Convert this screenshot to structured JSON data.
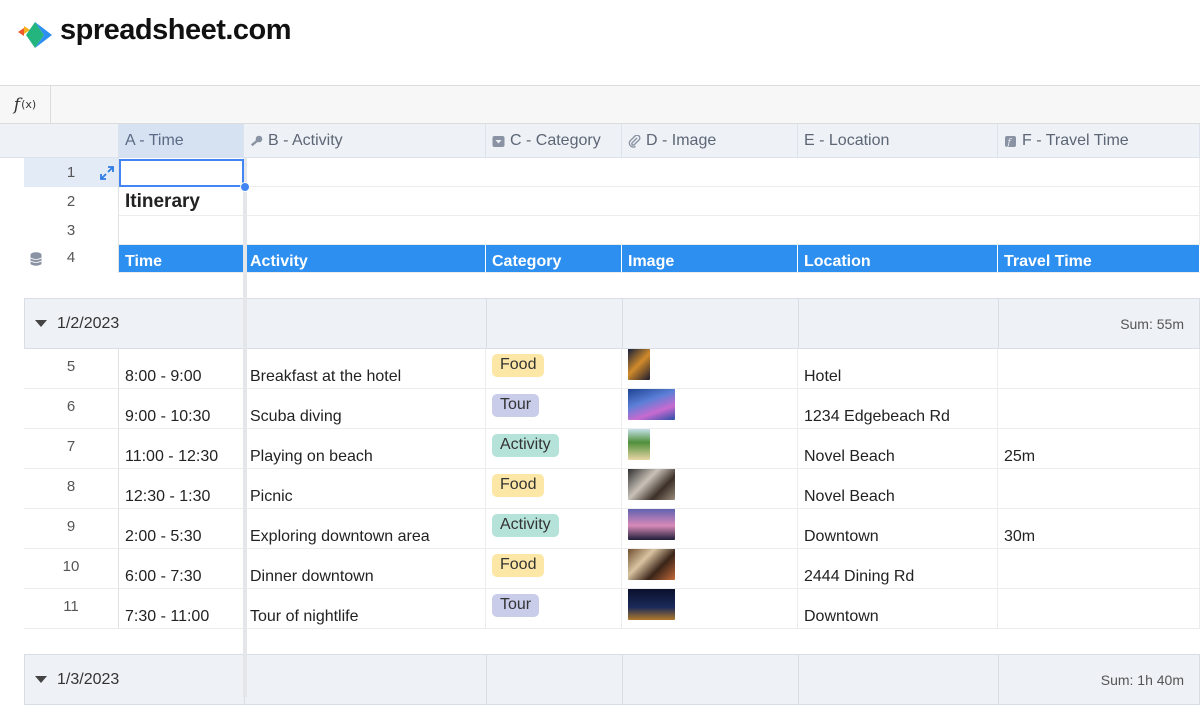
{
  "brand": {
    "name": "spreadsheet.com",
    "colors": [
      "#f0592a",
      "#f7b21b",
      "#24b47e",
      "#2d8ff0"
    ]
  },
  "formula_bar": {
    "icon": "function-icon",
    "label": "f",
    "sub": "(x)"
  },
  "columns": [
    {
      "label": "A - Time",
      "icon": ""
    },
    {
      "label": "B - Activity",
      "icon": "key-icon"
    },
    {
      "label": "C - Category",
      "icon": "dropdown-icon"
    },
    {
      "label": "D - Image",
      "icon": "paperclip-icon"
    },
    {
      "label": "E - Location",
      "icon": ""
    },
    {
      "label": "F - Travel Time",
      "icon": "formula-icon"
    }
  ],
  "top_rows": [
    {
      "num": "1",
      "a": ""
    },
    {
      "num": "2",
      "a": "Itinerary"
    },
    {
      "num": "3",
      "a": ""
    }
  ],
  "header_row": {
    "num": "4",
    "cells": [
      "Time",
      "Activity",
      "Category",
      "Image",
      "Location",
      "Travel Time"
    ]
  },
  "groups": [
    {
      "label": "1/2/2023",
      "sum": "Sum: 55m",
      "rows": [
        {
          "num": "5",
          "time": "8:00 - 9:00",
          "activity": "Breakfast at the hotel",
          "category": "Food",
          "location": "Hotel",
          "travel": ""
        },
        {
          "num": "6",
          "time": "9:00 - 10:30",
          "activity": "Scuba diving",
          "category": "Tour",
          "location": "1234 Edgebeach Rd",
          "travel": ""
        },
        {
          "num": "7",
          "time": "11:00 - 12:30",
          "activity": "Playing on beach",
          "category": "Activity",
          "location": "Novel Beach",
          "travel": "25m"
        },
        {
          "num": "8",
          "time": "12:30 - 1:30",
          "activity": "Picnic",
          "category": "Food",
          "location": "Novel Beach",
          "travel": ""
        },
        {
          "num": "9",
          "time": "2:00 - 5:30",
          "activity": "Exploring downtown area",
          "category": "Activity",
          "location": "Downtown",
          "travel": "30m"
        },
        {
          "num": "10",
          "time": "6:00 - 7:30",
          "activity": "Dinner downtown",
          "category": "Food",
          "location": "2444 Dining Rd",
          "travel": ""
        },
        {
          "num": "11",
          "time": "7:30 - 11:00",
          "activity": "Tour of nightlife",
          "category": "Tour",
          "location": "Downtown",
          "travel": ""
        }
      ]
    },
    {
      "label": "1/3/2023",
      "sum": "Sum: 1h 40m",
      "rows": []
    }
  ],
  "tag_colors": {
    "Food": {
      "bg": "#fde7a6",
      "fg": "#333333"
    },
    "Tour": {
      "bg": "#c9cdea",
      "fg": "#333333"
    },
    "Activity": {
      "bg": "#b5e3da",
      "fg": "#333333"
    }
  },
  "header_color": "#2d8ff0",
  "accent_selection": "#4285f4"
}
